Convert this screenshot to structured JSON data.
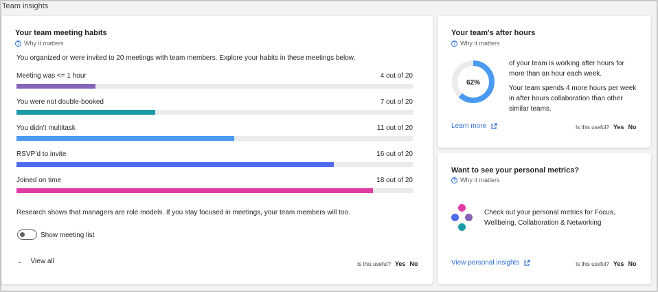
{
  "page": {
    "title": "Team insights"
  },
  "meeting_habits": {
    "title": "Your team meeting habits",
    "why_label": "Why it matters",
    "intro": "You organized or were invited to 20 meetings with team members.  Explore your habits in these meetings below.",
    "metrics": [
      {
        "label": "Meeting was <= 1 hour",
        "count": "4 out of 20",
        "fraction": 0.2,
        "color": "#8764b8"
      },
      {
        "label": "You were not double-booked",
        "count": "7 out of 20",
        "fraction": 0.35,
        "color": "#1a9ba6"
      },
      {
        "label": "You didn’t multitask",
        "count": "11 out of 20",
        "fraction": 0.55,
        "color": "#4a9af0"
      },
      {
        "label": "RSVP’d to invite",
        "count": "16 out of 20",
        "fraction": 0.8,
        "color": "#4f6bed"
      },
      {
        "label": "Joined on time",
        "count": "18 out of 20",
        "fraction": 0.9,
        "color": "#e03ca4"
      }
    ],
    "research": "Research shows that managers are role models. If you stay focused in meetings, your team members will too.",
    "toggle_label": "Show meeting list",
    "toggle_on": false,
    "view_all": "View all",
    "useful_q": "Is this useful?",
    "yes": "Yes",
    "no": "No"
  },
  "after_hours": {
    "title": "Your team's after hours",
    "why_label": "Why it matters",
    "percent_label": "62%",
    "percent": 0.62,
    "ring_color": "#4a9af0",
    "desc1": "of your team is working after hours for more than an hour each week.",
    "desc2": "Your team spends 4 more hours per week in after hours collaboration than other similar teams.",
    "learn_more": "Learn more",
    "useful_q": "Is this useful?",
    "yes": "Yes",
    "no": "No"
  },
  "personal": {
    "title": "Want to see your personal metrics?",
    "why_label": "Why it matters",
    "desc": "Check out your personal metrics for Focus, Wellbeing, Collaboration & Networking",
    "link": "View personal insights",
    "useful_q": "Is this useful?",
    "yes": "Yes",
    "no": "No"
  }
}
